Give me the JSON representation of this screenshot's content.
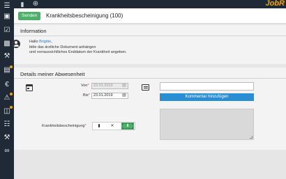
{
  "topbar": {
    "icons": [
      "bookmark-icon",
      "add-icon"
    ],
    "brand": "JobR"
  },
  "sidebar": {
    "icons": [
      "menu-icon",
      "inbox-icon",
      "checkbox-icon",
      "document-icon",
      "tools-icon",
      "chat-icon",
      "euro-icon",
      "alert-icon",
      "documents-icon",
      "list-icon",
      "wrench-icon",
      "link-icon"
    ]
  },
  "header": {
    "send_label": "Senden",
    "title": "Krankheitsbescheinigung (100)"
  },
  "information": {
    "title": "Information",
    "greeting": "Hallo ",
    "name": "Brigitte",
    "greeting_end": ",",
    "line2": "bitte das ärztliche Dokument anhängen",
    "line3": "und vorraussichtliches Enddatum der Krankheit angeben."
  },
  "details": {
    "title": "Details meiner Abwesenheit",
    "from_label": "Von",
    "from_value": "23.01.2019",
    "to_label": "Bis",
    "to_value": "23.01.2019",
    "certificate_label": "Krankheitsbescheinigung",
    "required_mark": "*",
    "comment_placeholder": "",
    "comment_button": "Kommentar hinzufügen"
  }
}
